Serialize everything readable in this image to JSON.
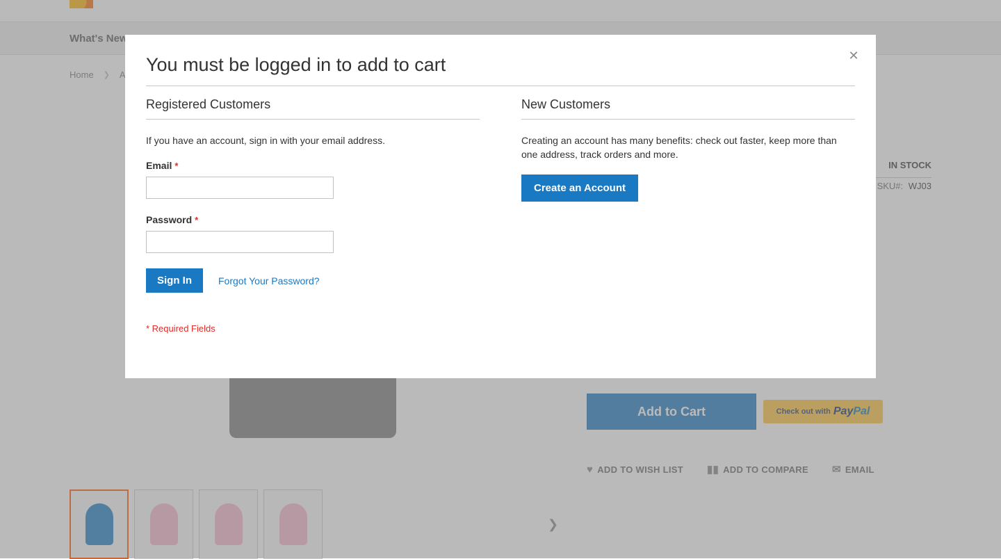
{
  "nav": {
    "whats_new": "What's New"
  },
  "breadcrumbs": {
    "home": "Home",
    "next_partial": "A"
  },
  "product": {
    "stock_status": "IN STOCK",
    "sku_label": "SKU#:",
    "sku_value": "WJ03",
    "add_to_cart": "Add to Cart",
    "paypal_prefix": "Check out with",
    "paypal_pay": "Pay",
    "paypal_pal": "Pal",
    "wishlist": "ADD TO WISH LIST",
    "compare": "ADD TO COMPARE",
    "email": "EMAIL"
  },
  "modal": {
    "title": "You must be logged in to add to cart",
    "registered": {
      "heading": "Registered Customers",
      "intro": "If you have an account, sign in with your email address.",
      "email_label": "Email",
      "password_label": "Password",
      "signin_btn": "Sign In",
      "forgot": "Forgot Your Password?",
      "required_note": "* Required Fields"
    },
    "new_customers": {
      "heading": "New Customers",
      "intro": "Creating an account has many benefits: check out faster, keep more than one address, track orders and more.",
      "create_btn": "Create an Account"
    }
  }
}
